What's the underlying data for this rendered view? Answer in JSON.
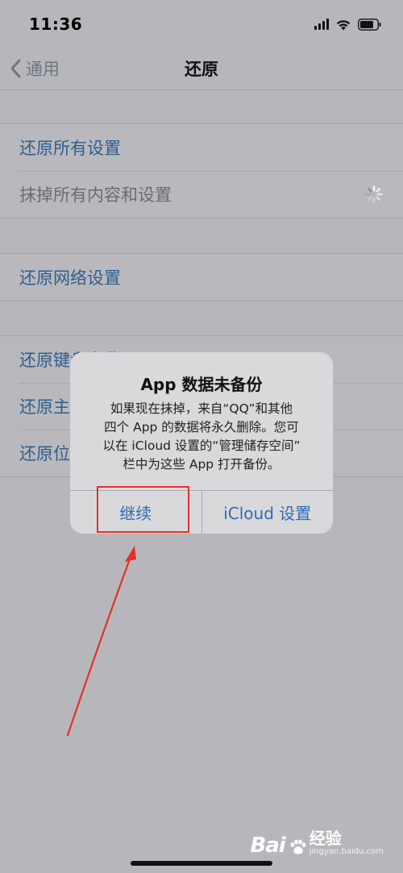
{
  "status_bar": {
    "time": "11:36"
  },
  "nav": {
    "back_label": "通用",
    "title": "还原"
  },
  "groups": [
    {
      "rows": [
        {
          "label": "还原所有设置"
        },
        {
          "label": "抹掉所有内容和设置"
        }
      ]
    },
    {
      "rows": [
        {
          "label": "还原网络设置"
        }
      ]
    },
    {
      "rows": [
        {
          "label": "还原键盘字典"
        },
        {
          "label": "还原主屏幕布局"
        },
        {
          "label": "还原位置与隐私"
        }
      ]
    }
  ],
  "alert": {
    "title": "App 数据未备份",
    "message_lines": [
      "如果现在抹掉，来自“QQ”和其他",
      "四个 App 的数据将永久删除。您可",
      "以在 iCloud 设置的“管理储存空间”",
      "栏中为这些 App 打开备份。"
    ],
    "continue_label": "继续",
    "icloud_label": "iCloud 设置"
  },
  "watermark": {
    "logo": "Bai",
    "brand": "经验",
    "domain": "jingyan.baidu.com"
  },
  "colors": {
    "link": "#2f5d8c",
    "alert_button": "#2f6bb3",
    "annotation": "#e4312b"
  }
}
